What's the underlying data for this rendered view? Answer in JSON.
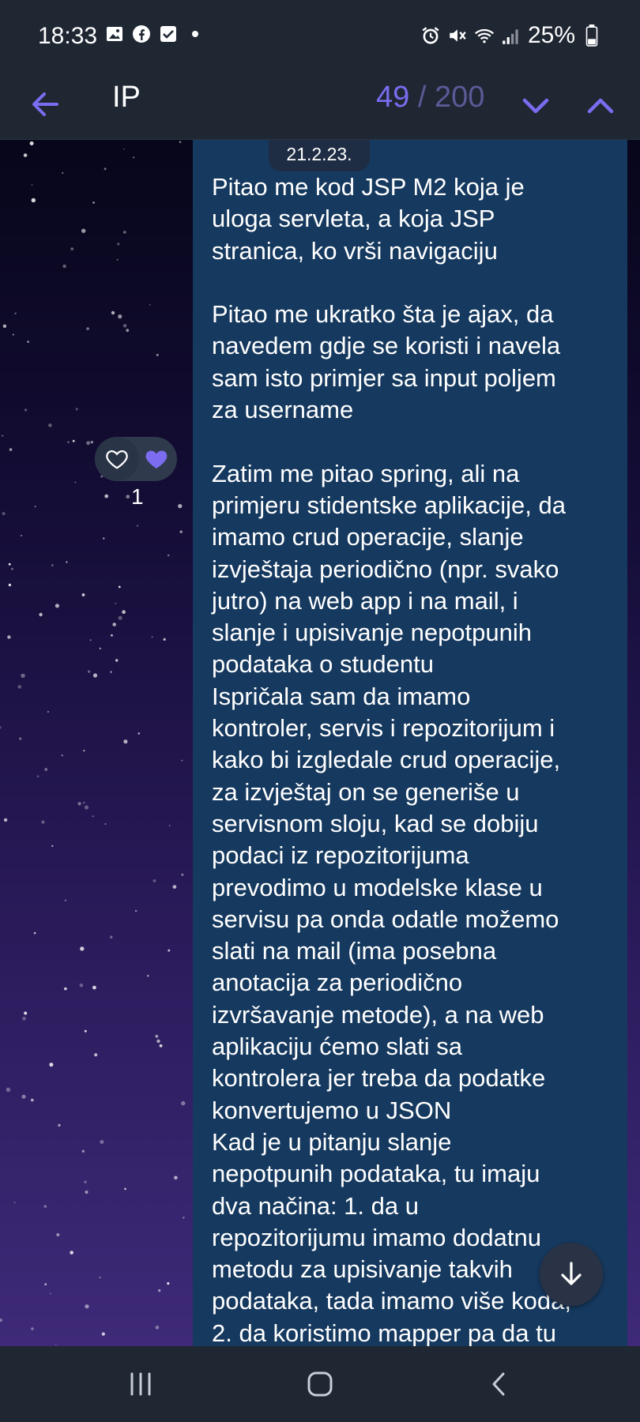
{
  "status_bar": {
    "time": "18:33",
    "left_icons": [
      "gallery-icon",
      "facebook-icon",
      "checkbox-icon",
      "dot-icon"
    ],
    "right_icons": [
      "alarm-icon",
      "mute-icon",
      "wifi-icon",
      "signal-icon"
    ],
    "battery": "25%"
  },
  "app_bar": {
    "title": "IP",
    "search_current": "49",
    "search_separator": "/",
    "search_total": "200"
  },
  "message": {
    "date": "21.2.23.",
    "lines": [
      "Pitao me kod JSP M2 koja je",
      "uloga servleta, a koja JSP",
      "stranica, ko vrši navigaciju",
      "",
      "Pitao me ukratko šta je ajax, da",
      "navedem gdje se koristi i navela",
      "sam isto primjer sa input poljem",
      "za username",
      "",
      "Zatim me pitao spring, ali na",
      "primjeru stidentske aplikacije, da",
      "imamo crud operacije, slanje",
      "izvještaja periodično (npr. svako",
      "jutro) na web app i na mail, i",
      "slanje i upisivanje nepotpunih",
      "podataka o studentu",
      "Ispričala sam da imamo",
      "kontroler, servis i repozitorijum i",
      "kako bi izgledale crud operacije,",
      "za izvještaj on se generiše u",
      "servisnom sloju, kad se dobiju",
      "podaci iz repozitorijuma",
      "prevodimo u modelske klase u",
      "servisu pa onda odatle možemo",
      "slati na mail (ima posebna",
      "anotacija za periodično",
      "izvršavanje metode), a na web",
      "aplikaciju ćemo slati sa",
      "kontrolera jer treba da podatke",
      "konvertujemo u JSON",
      "Kad je u pitanju slanje",
      "nepotpunih podataka, tu imaju",
      "dva načina: 1. da u",
      "repozitorijumu imamo dodatnu",
      "metodu za upisivanje takvih",
      "podataka, tada imamo više koda,",
      "2. da koristimo mapper pa da tu"
    ]
  },
  "reactions": {
    "count": "1"
  },
  "colors": {
    "accent": "#7b6cf0",
    "bubble": "#16395f",
    "bar": "#1f2733"
  }
}
